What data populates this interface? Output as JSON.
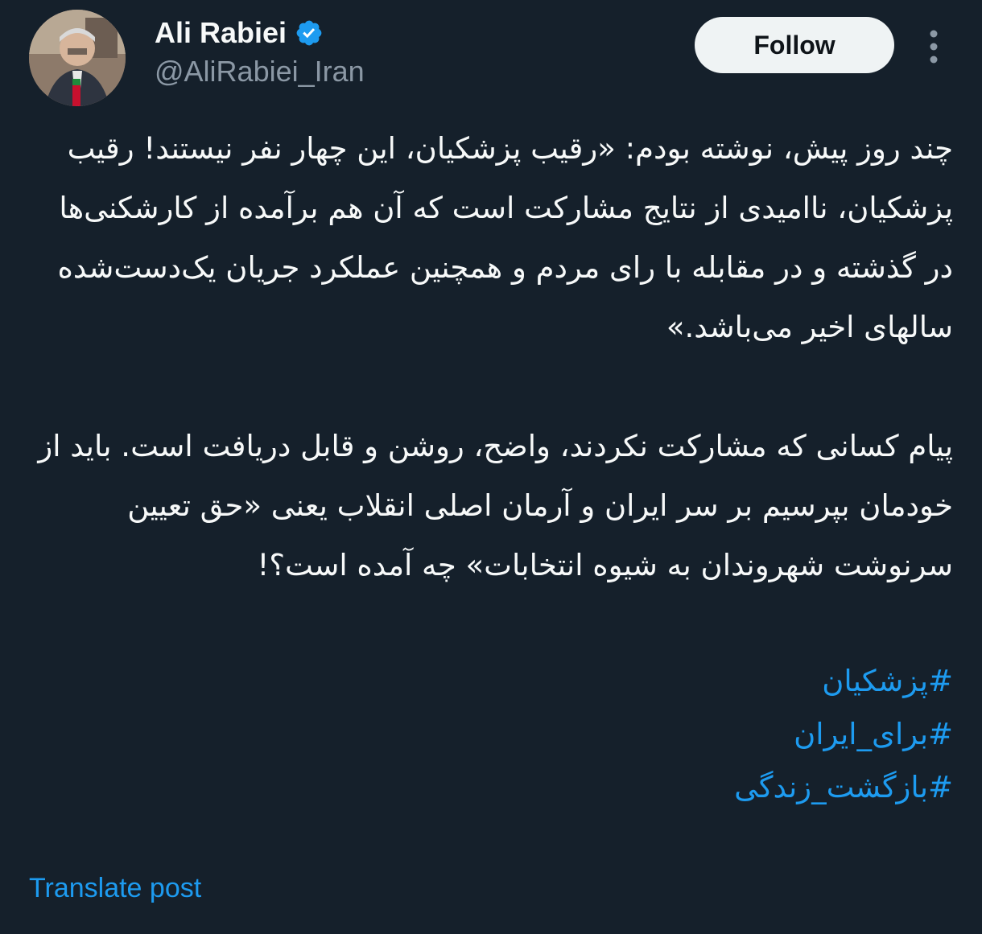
{
  "author": {
    "display_name": "Ali Rabiei",
    "handle": "@AliRabiei_Iran",
    "verified_icon": "verified-badge-icon",
    "avatar_icon": "profile-photo"
  },
  "actions": {
    "follow_label": "Follow",
    "more_icon": "more-vertical-icon"
  },
  "tweet": {
    "paragraph_1": "چند روز پیش، نوشته بودم: «رقیب پزشکیان، این چهار نفر نیستند! رقیب پزشکیان، ناامیدی از نتایج مشارکت است که آن هم برآمده از کارشکنی‌ها در گذشته و در مقابله با رای مردم و همچنین عملکرد جریان یک‌دست‌شده سالهای اخیر می‌باشد.»",
    "paragraph_2": "پیام کسانی که مشارکت نکردند، واضح، روشن و قابل دریافت است. باید از خودمان بپرسیم بر سر ایران و آرمان اصلی انقلاب یعنی «حق تعیین سرنوشت شهروندان به شیوه انتخابات» چه آمده است؟!",
    "hashtags": [
      "#پزشکیان",
      "#برای_ایران",
      "#بازگشت_زندگی"
    ]
  },
  "translate_label": "Translate post",
  "colors": {
    "background": "#15202b",
    "text": "#f7f9f9",
    "muted": "#8b98a5",
    "accent": "#1d9bf0",
    "button_bg": "#eff3f4"
  }
}
